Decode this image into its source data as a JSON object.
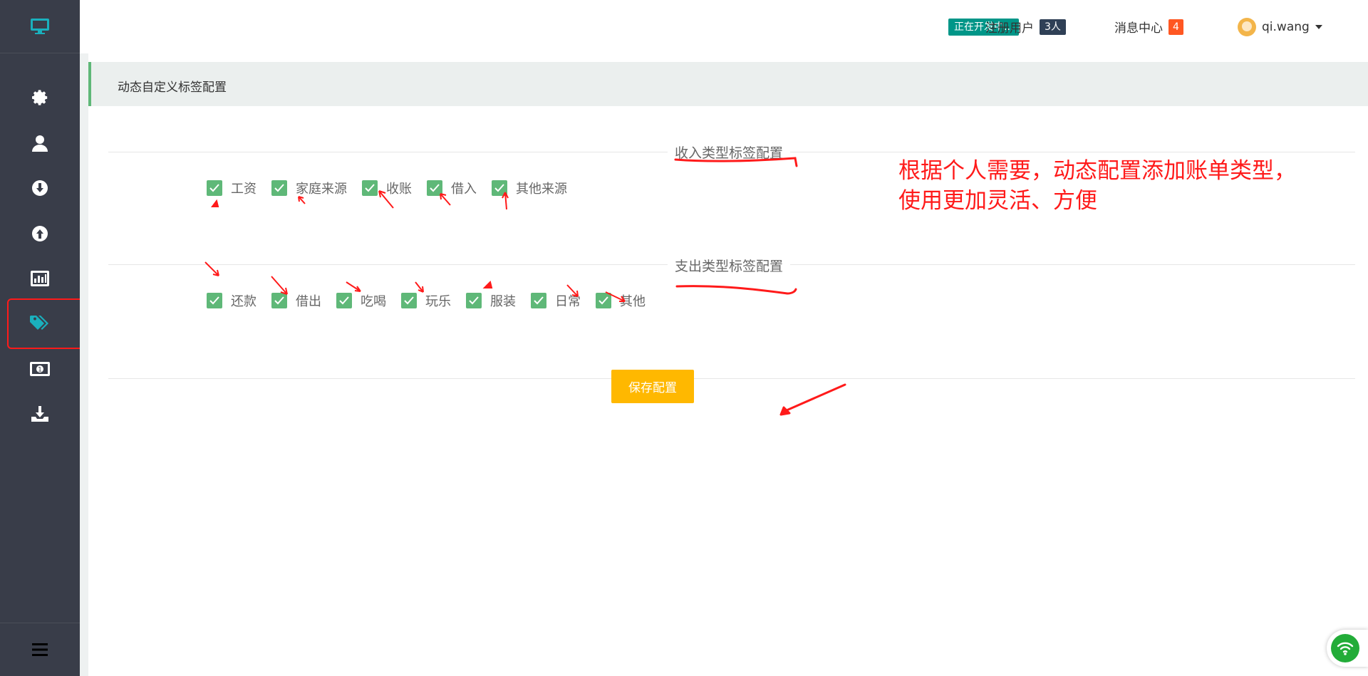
{
  "header": {
    "status_tag": "正在开发中...",
    "registered_label": "注册用户",
    "registered_count": "3人",
    "messages_label": "消息中心",
    "messages_count": "4",
    "username": "qi.wang"
  },
  "sidebar": {
    "items": [
      {
        "icon": "gear-icon",
        "active": false
      },
      {
        "icon": "user-icon",
        "active": false
      },
      {
        "icon": "income-down-icon",
        "active": false
      },
      {
        "icon": "expense-up-icon",
        "active": false
      },
      {
        "icon": "chart-icon",
        "active": false
      },
      {
        "icon": "tags-icon",
        "active": true
      },
      {
        "icon": "money-icon",
        "active": false
      },
      {
        "icon": "download-icon",
        "active": false
      }
    ],
    "footer_icon": "menu-icon",
    "accent": "#1ab0bd"
  },
  "page": {
    "title": "动态自定义标签配置",
    "income_legend": "收入类型标签配置",
    "income_tags": [
      "工资",
      "家庭来源",
      "收账",
      "借入",
      "其他来源"
    ],
    "expense_legend": "支出类型标签配置",
    "expense_tags": [
      "还款",
      "借出",
      "吃喝",
      "玩乐",
      "服装",
      "日常",
      "其他"
    ],
    "save_label": "保存配置"
  },
  "annotation": {
    "note": "根据个人需要，动态配置添加账单类型，使用更加灵活、方便",
    "color": "#ff1a1a"
  },
  "colors": {
    "sidebar_bg": "#393d49",
    "checkbox": "#5fb878",
    "save_button": "#ffb800",
    "status_tag": "#009688",
    "message_badge": "#ff5722"
  }
}
